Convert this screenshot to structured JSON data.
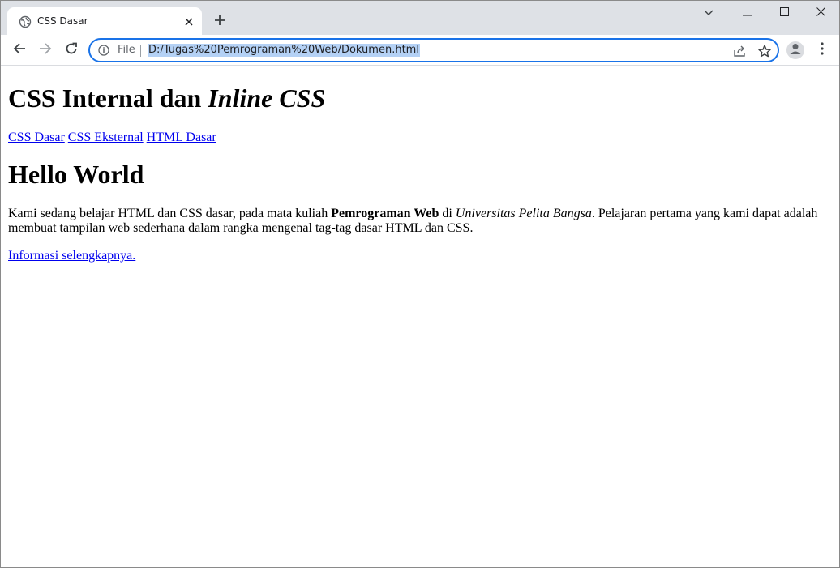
{
  "browser": {
    "tab": {
      "title": "CSS Dasar"
    },
    "address": {
      "scheme_label": "File",
      "url": "D:/Tugas%20Pemrograman%20Web/Dokumen.html"
    },
    "colors": {
      "accent": "#1a73e8",
      "tabstrip_bg": "#dee1e6",
      "selection": "#b4d1f5",
      "link": "#0000ee"
    }
  },
  "page": {
    "heading": {
      "normal": "CSS Internal dan ",
      "italic": "Inline CSS"
    },
    "links": [
      {
        "label": "CSS Dasar"
      },
      {
        "label": "CSS Eksternal"
      },
      {
        "label": "HTML Dasar"
      }
    ],
    "hello": "Hello World",
    "paragraph": {
      "part1": "Kami sedang belajar HTML dan CSS dasar, pada mata kuliah ",
      "bold": "Pemrograman Web",
      "part2": " di ",
      "italic": "Universitas Pelita Bangsa",
      "part3": ". Pelajaran pertama yang kami dapat adalah membuat tampilan web sederhana dalam rangka mengenal tag-tag dasar HTML dan CSS."
    },
    "more_link": "Informasi selengkapnya."
  }
}
